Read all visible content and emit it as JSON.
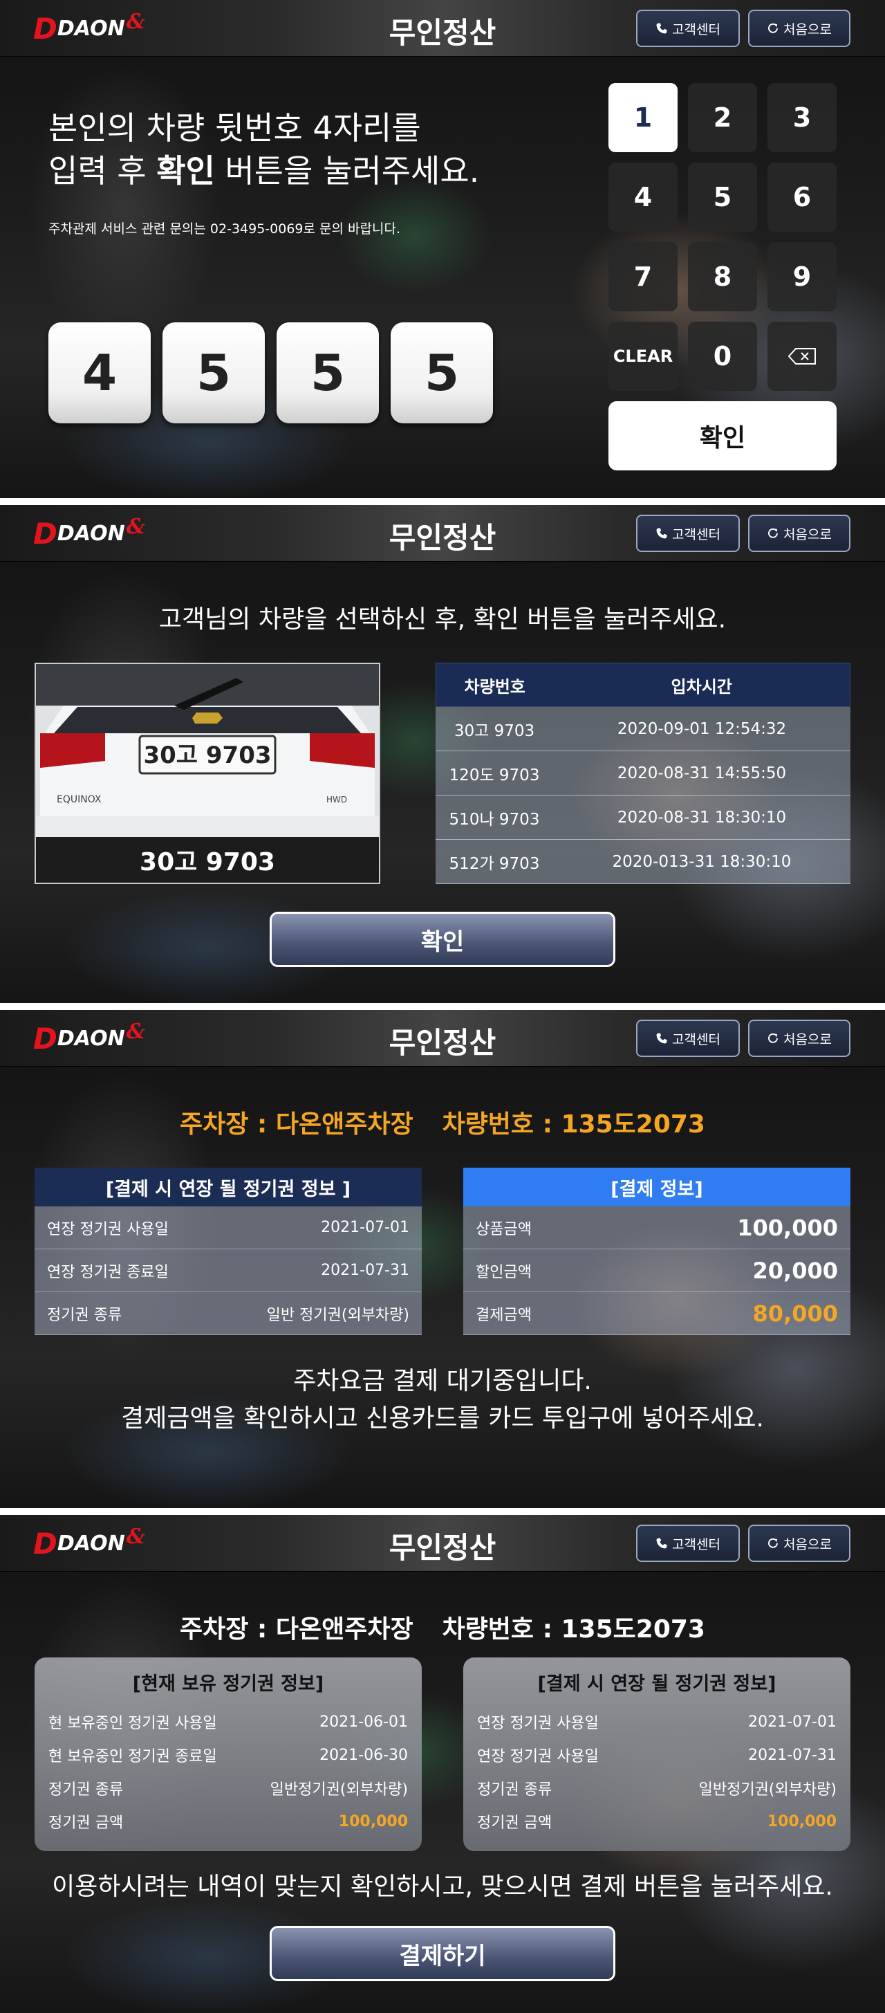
{
  "header": {
    "logo_d": "D",
    "logo_text": "DAON",
    "logo_amp": "&",
    "title": "무인정산",
    "customer_center": "고객센터",
    "home": "처음으로"
  },
  "screen1": {
    "instruction_line1": "본인의 차량 뒷번호 4자리를",
    "instruction_line2_pre": "입력 후 ",
    "instruction_line2_bold": "확인",
    "instruction_line2_post": " 버튼을 눌러주세요.",
    "contact": "주차관제 서비스 관련 문의는 02-3495-0069로 문의 바랍니다.",
    "digits": [
      "4",
      "5",
      "5",
      "5"
    ],
    "keypad": [
      "1",
      "2",
      "3",
      "4",
      "5",
      "6",
      "7",
      "8",
      "9",
      "CLEAR",
      "0"
    ],
    "confirm": "확인"
  },
  "screen2": {
    "instruction": "고객님의 차량을 선택하신 후, 확인 버튼을 눌러주세요.",
    "plate_on_car": "30고 9703",
    "car_brand_left": "EQUINOX",
    "car_brand_right": "HWD",
    "selected_plate": "30고 9703",
    "table_headers": [
      "차량번호",
      "입차시간"
    ],
    "rows": [
      [
        "30고 9703",
        "2020-09-01 12:54:32"
      ],
      [
        "120도 9703",
        "2020-08-31 14:55:50"
      ],
      [
        "510나 9703",
        "2020-08-31 18:30:10"
      ],
      [
        "512가 9703",
        "2020-013-31 18:30:10"
      ]
    ],
    "confirm": "확인"
  },
  "screen3": {
    "parking": "주차장 : 다온앤주차장",
    "vehicle": "차량번호 : 135도2073",
    "extend_title": "[결제 시 연장 될 정기권 정보 ]",
    "extend_rows": [
      [
        "연장 정기권 사용일",
        "2021-07-01"
      ],
      [
        "연장 정기권 종료일",
        "2021-07-31"
      ],
      [
        "정기권 종류",
        "일반 정기권(외부차량)"
      ]
    ],
    "payment_title": "[결제 정보]",
    "payment_rows": [
      [
        "상품금액",
        "100,000"
      ],
      [
        "할인금액",
        "20,000"
      ],
      [
        "결제금액",
        "80,000"
      ]
    ],
    "message_line1": "주차요금 결제 대기중입니다.",
    "message_line2": "결제금액을 확인하시고 신용카드를 카드 투입구에 넣어주세요.",
    "accent_color": "#f5a623"
  },
  "screen4": {
    "parking": "주차장 : 다온앤주차장",
    "vehicle": "차량번호 : 135도2073",
    "current_title": "[현재 보유 정기권 정보]",
    "current_rows": [
      [
        "현 보유중인 정기권 사용일",
        "2021-06-01"
      ],
      [
        "현 보유중인 정기권 종료일",
        "2021-06-30"
      ],
      [
        "정기권 종류",
        "일반정기권(외부차량)"
      ],
      [
        "정기권 금액",
        "100,000"
      ]
    ],
    "extend_title": "[결제 시 연장 될 정기권 정보]",
    "extend_rows": [
      [
        "연장 정기권 사용일",
        "2021-07-01"
      ],
      [
        "연장 정기권 사용일",
        "2021-07-31"
      ],
      [
        "정기권 종류",
        "일반정기권(외부차량)"
      ],
      [
        "정기권 금액",
        "100,000"
      ]
    ],
    "message": "이용하시려는 내역이 맞는지 확인하시고, 맞으시면 결제 버튼을 눌러주세요.",
    "pay_button": "결제하기"
  }
}
